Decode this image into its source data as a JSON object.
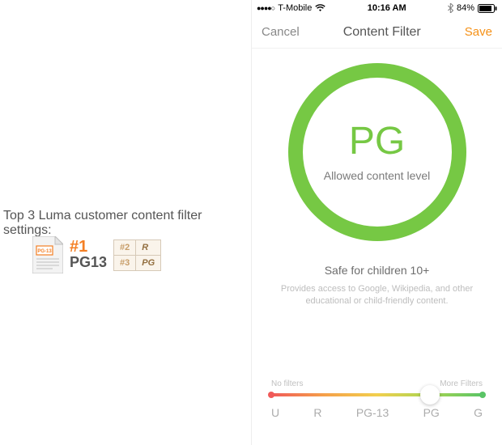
{
  "left": {
    "title": "Top 3 Luma customer content filter settings:",
    "doc_badge": "PG-13",
    "rank1_number": "#1",
    "rank1_label": "PG13",
    "table": [
      {
        "idx": "#2",
        "val": "R"
      },
      {
        "idx": "#3",
        "val": "PG"
      }
    ]
  },
  "status": {
    "carrier": "T-Mobile",
    "time": "10:16 AM",
    "battery_pct": "84%"
  },
  "nav": {
    "cancel": "Cancel",
    "title": "Content Filter",
    "save": "Save"
  },
  "dial": {
    "rating": "PG",
    "caption": "Allowed content level"
  },
  "body": {
    "safe_line": "Safe for children 10+",
    "description": "Provides access to Google, Wikipedia, and other educational or child-friendly content."
  },
  "slider": {
    "left_label": "No filters",
    "right_label": "More Filters",
    "ticks": [
      "U",
      "R",
      "PG-13",
      "PG",
      "G"
    ],
    "thumb_index": 3
  },
  "colors": {
    "accent_green": "#76c844",
    "accent_orange": "#f59117"
  }
}
